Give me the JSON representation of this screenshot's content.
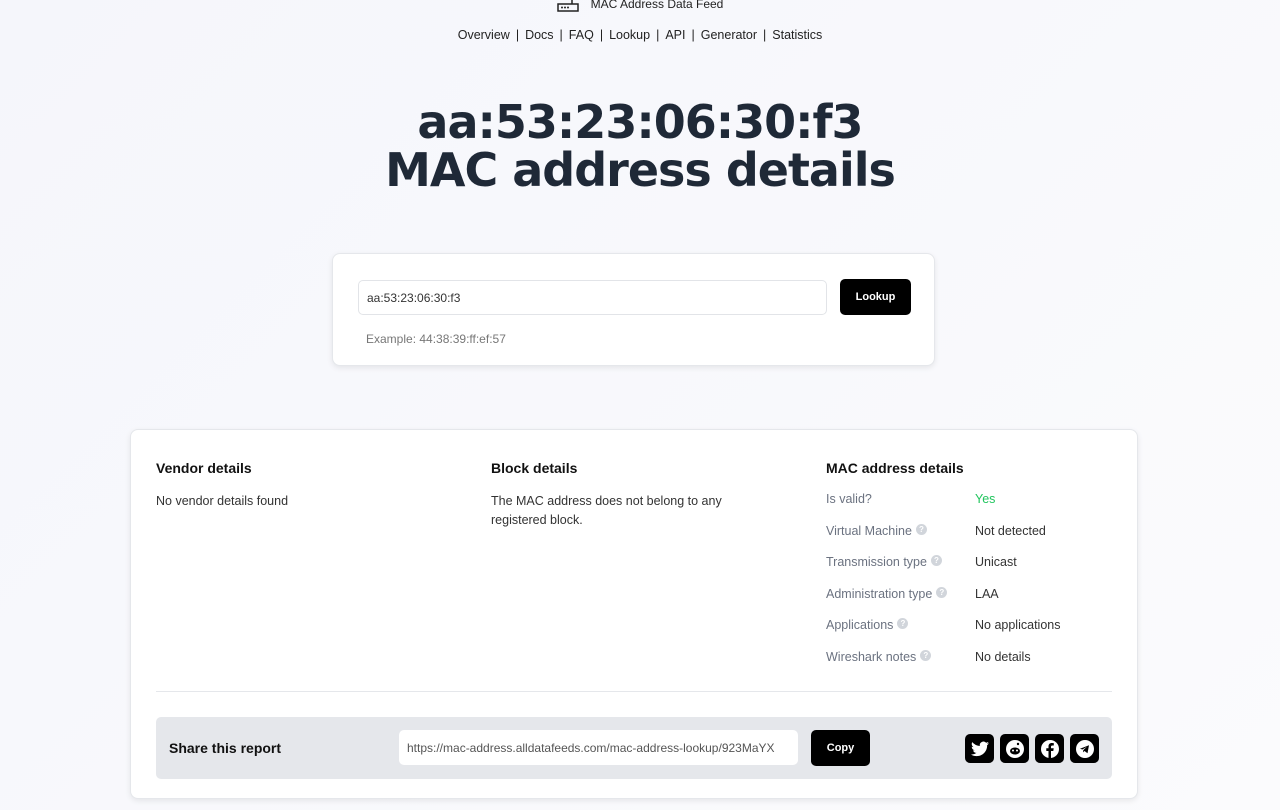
{
  "brand": {
    "name": "MAC Address Data Feed",
    "icon": "router-icon"
  },
  "nav": [
    "Overview",
    "Docs",
    "FAQ",
    "Lookup",
    "API",
    "Generator",
    "Statistics"
  ],
  "title": {
    "line1": "aa:53:23:06:30:f3",
    "line2": "MAC address details"
  },
  "lookup": {
    "value": "aa:53:23:06:30:f3",
    "button": "Lookup",
    "example": "Example: 44:38:39:ff:ef:57"
  },
  "vendor": {
    "title": "Vendor details",
    "text": "No vendor details found"
  },
  "block": {
    "title": "Block details",
    "text": "The MAC address does not belong to any registered block."
  },
  "mac": {
    "title": "MAC address details",
    "rows": [
      {
        "k": "Is valid?",
        "v": "Yes",
        "help": false
      },
      {
        "k": "Virtual Machine",
        "v": "Not detected",
        "help": true
      },
      {
        "k": "Transmission type",
        "v": "Unicast",
        "help": true
      },
      {
        "k": "Administration type",
        "v": "LAA",
        "help": true
      },
      {
        "k": "Applications",
        "v": "No applications",
        "help": true
      },
      {
        "k": "Wireshark notes",
        "v": "No details",
        "help": true
      }
    ]
  },
  "share": {
    "label": "Share this report",
    "url": "https://mac-address.alldatafeeds.com/mac-address-lookup/923MaYX",
    "button": "Copy",
    "social": [
      "twitter-icon",
      "reddit-icon",
      "facebook-icon",
      "telegram-icon"
    ]
  },
  "colors": {
    "valid": "#22c55e"
  }
}
